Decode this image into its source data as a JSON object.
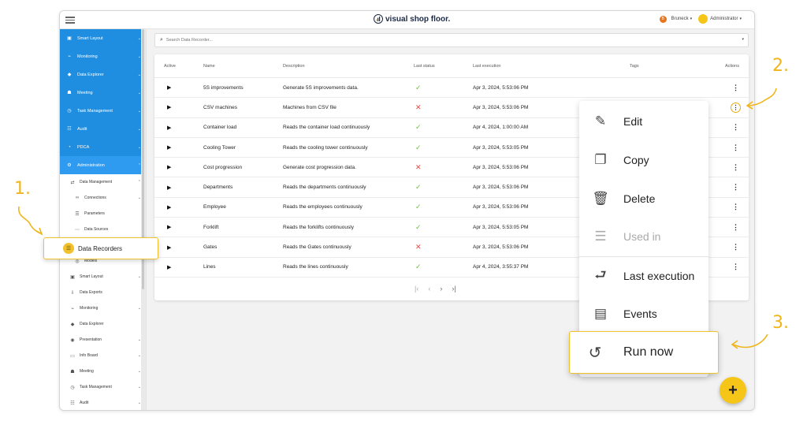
{
  "app": {
    "brand": "visual shop floor.",
    "user_menu": "Bruneck",
    "user_badge": "B",
    "admin_menu": "Administrator"
  },
  "sidebar": {
    "top_items": [
      {
        "label": "Smart Layout",
        "icon": "▣"
      },
      {
        "label": "Monitoring",
        "icon": "⌁"
      },
      {
        "label": "Data Explorer",
        "icon": "◆"
      },
      {
        "label": "Meeting",
        "icon": "☗"
      },
      {
        "label": "Task Management",
        "icon": "◷"
      },
      {
        "label": "Audit",
        "icon": "☷"
      },
      {
        "label": "PDCA",
        "icon": "◔"
      },
      {
        "label": "Administration",
        "icon": "⚙"
      }
    ],
    "data_management": "Data Management",
    "connections": "Connections",
    "parameters": "Parameters",
    "data_sources": "Data Sources",
    "models": "Models",
    "lower_items": [
      {
        "label": "Smart Layout",
        "icon": "▣",
        "chev": "⌄"
      },
      {
        "label": "Data Exports",
        "icon": "⇩",
        "chev": ""
      },
      {
        "label": "Monitoring",
        "icon": "⌁",
        "chev": "⌄"
      },
      {
        "label": "Data Explorer",
        "icon": "◆",
        "chev": ""
      },
      {
        "label": "Presentation",
        "icon": "◉",
        "chev": "⌄"
      },
      {
        "label": "Info Board",
        "icon": "▭",
        "chev": "⌄"
      },
      {
        "label": "Meeting",
        "icon": "☗",
        "chev": "⌄"
      },
      {
        "label": "Task Management",
        "icon": "◷",
        "chev": "⌄"
      },
      {
        "label": "Audit",
        "icon": "☷",
        "chev": "⌄"
      }
    ]
  },
  "search": {
    "placeholder": "Search Data Recorder..."
  },
  "table": {
    "headers": {
      "active": "Active",
      "name": "Name",
      "description": "Description",
      "status": "Last status",
      "execution": "Last execution",
      "tags": "Tags",
      "actions": "Actions"
    },
    "rows": [
      {
        "name": "5S improvements",
        "description": "Generate 5S improvements data.",
        "status": "ok",
        "execution": "Apr 3, 2024, 5:53:06 PM"
      },
      {
        "name": "CSV machines",
        "description": "Machines from CSV file",
        "status": "fail",
        "execution": "Apr 3, 2024, 5:53:06 PM"
      },
      {
        "name": "Container load",
        "description": "Reads the container load continuously",
        "status": "ok",
        "execution": "Apr 4, 2024, 1:00:00 AM"
      },
      {
        "name": "Cooling Tower",
        "description": "Reads the cooling tower continuously",
        "status": "ok",
        "execution": "Apr 3, 2024, 5:53:05 PM"
      },
      {
        "name": "Cost progression",
        "description": "Generate cost progression data.",
        "status": "fail",
        "execution": "Apr 3, 2024, 5:53:06 PM"
      },
      {
        "name": "Departments",
        "description": "Reads the departments continuously",
        "status": "ok",
        "execution": "Apr 3, 2024, 5:53:06 PM"
      },
      {
        "name": "Employee",
        "description": "Reads the employees continuously",
        "status": "ok",
        "execution": "Apr 3, 2024, 5:53:06 PM"
      },
      {
        "name": "Forklift",
        "description": "Reads the forklifts continuously",
        "status": "ok",
        "execution": "Apr 3, 2024, 5:53:05 PM"
      },
      {
        "name": "Gates",
        "description": "Reads the Gates continuously",
        "status": "fail",
        "execution": "Apr 3, 2024, 5:53:06 PM"
      },
      {
        "name": "Lines",
        "description": "Reads the lines continuously",
        "status": "ok",
        "execution": "Apr 4, 2024, 3:55:37 PM"
      }
    ]
  },
  "menu": {
    "edit": "Edit",
    "copy": "Copy",
    "delete": "Delete",
    "used_in": "Used in",
    "last_execution": "Last execution",
    "events": "Events",
    "run_now": "Run now"
  },
  "callout": {
    "label": "Data Recorders"
  },
  "annotations": {
    "step1": "1.",
    "step2": "2.",
    "step3": "3."
  },
  "colors": {
    "accent": "#f2c12e",
    "sidebar_blue": "#1f8ee0",
    "success": "#6cbf3d",
    "error": "#e4453a"
  }
}
